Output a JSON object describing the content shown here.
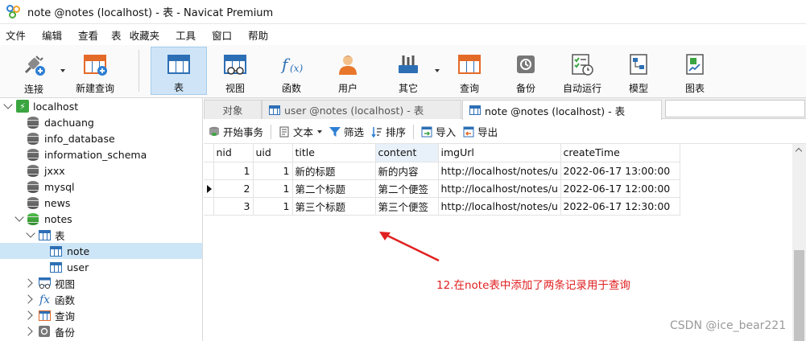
{
  "window": {
    "title": "note @notes (localhost) - 表 - Navicat Premium"
  },
  "menu": [
    "文件",
    "编辑",
    "查看",
    "表",
    "收藏夹",
    "工具",
    "窗口",
    "帮助"
  ],
  "toolbar": {
    "connect": "连接",
    "new_query": "新建查询",
    "table": "表",
    "view": "视图",
    "function": "函数",
    "user": "用户",
    "other": "其它",
    "query": "查询",
    "backup": "备份",
    "automation": "自动运行",
    "model": "模型",
    "chart": "图表"
  },
  "sidebar": {
    "connection": "localhost",
    "databases": [
      "dachuang",
      "info_database",
      "information_schema",
      "jxxx",
      "mysql",
      "news"
    ],
    "open_db": "notes",
    "tables_group": "表",
    "tables": [
      "note",
      "user"
    ],
    "groups": [
      "视图",
      "函数",
      "查询",
      "备份"
    ]
  },
  "tabs": {
    "objects": "对象",
    "user_tab": "user @notes (localhost) - 表",
    "note_tab": "note @notes (localhost) - 表"
  },
  "subtoolbar": {
    "begin_tx": "开始事务",
    "text": "文本",
    "filter": "筛选",
    "sort": "排序",
    "import": "导入",
    "export": "导出"
  },
  "grid": {
    "columns": [
      "nid",
      "uid",
      "title",
      "content",
      "imgUrl",
      "createTime"
    ],
    "rows": [
      [
        "1",
        "1",
        "新的标题",
        "新的内容",
        "http://localhost/notes/upl",
        "2022-06-17 13:00:00"
      ],
      [
        "2",
        "1",
        "第二个标题",
        "第二个便签",
        "http://localhost/notes/upl",
        "2022-06-17 12:00:00"
      ],
      [
        "3",
        "1",
        "第三个标题",
        "第三个便签",
        "http://localhost/notes/upl",
        "2022-06-17 12:30:00"
      ]
    ]
  },
  "annotation": "12.在note表中添加了两条记录用于查询",
  "watermark": "CSDN @ice_bear221",
  "colors": {
    "annotation": "#e02020",
    "accent": "#2d6fb5",
    "selection": "#cde6f7"
  }
}
